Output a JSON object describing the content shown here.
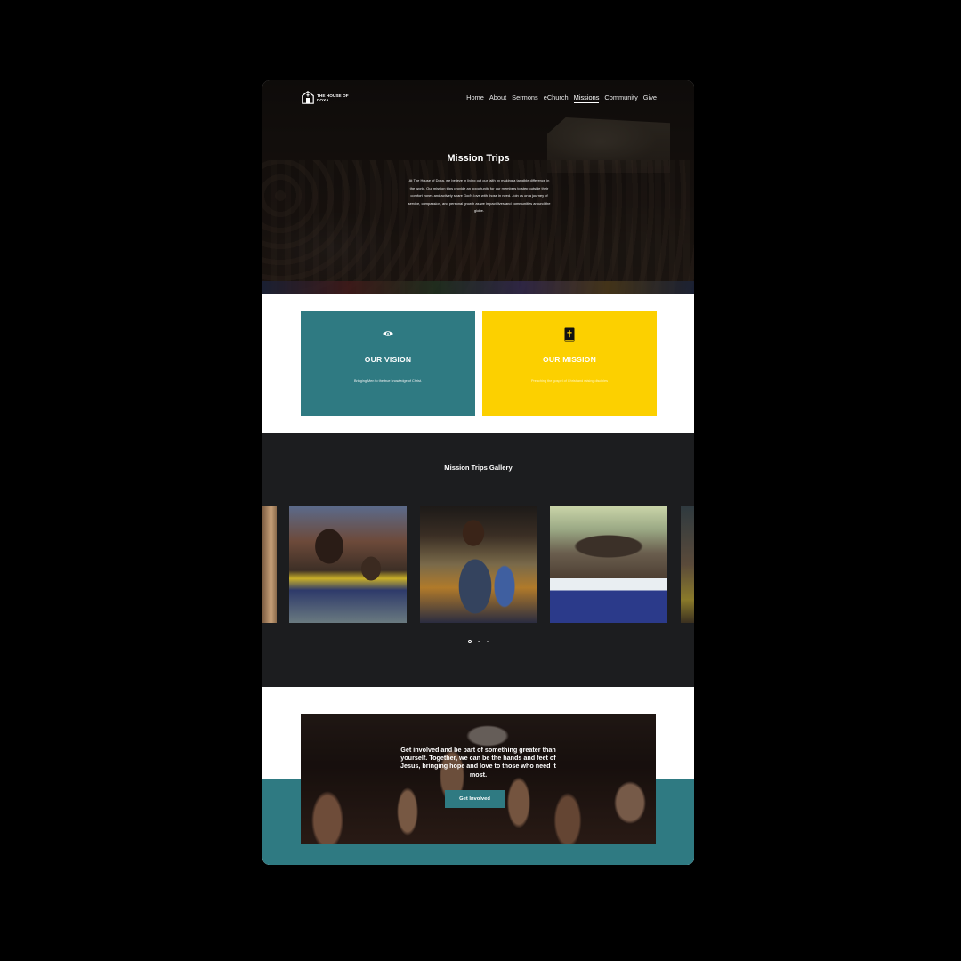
{
  "nav": {
    "logo_text": "THE HOUSE OF DOXA",
    "links": [
      {
        "label": "Home",
        "active": false
      },
      {
        "label": "About",
        "active": false
      },
      {
        "label": "Sermons",
        "active": false
      },
      {
        "label": "eChurch",
        "active": false
      },
      {
        "label": "Missions",
        "active": true
      },
      {
        "label": "Community",
        "active": false
      },
      {
        "label": "Give",
        "active": false
      }
    ]
  },
  "hero": {
    "title": "Mission Trips",
    "text": "At The House of Doxa, we believe in living out our faith by making a tangible difference in the world. Our mission trips provide an opportunity for our members to step outside their comfort zones and actively share God's love with those in need. Join us on a journey of service, compassion, and personal growth as we impact lives and communities around the globe."
  },
  "cards": {
    "vision": {
      "icon": "eye-icon",
      "title": "OUR VISION",
      "text": "Bringing Men to the true knowledge of Christ.",
      "color": "#2f7a82"
    },
    "mission": {
      "icon": "bible-icon",
      "title": "OUR MISSION",
      "text": "Preaching the gospel of Christ and raising disciples",
      "color": "#fcd000"
    }
  },
  "gallery": {
    "title": "Mission Trips Gallery",
    "dots": 3,
    "active_dot": 0
  },
  "cta": {
    "text": "Get involved and be part of something greater than yourself. Together, we can be the hands and feet of Jesus, bringing hope and love to those who need it most.",
    "button_label": "Get Involved",
    "accent": "#2f7a82"
  }
}
